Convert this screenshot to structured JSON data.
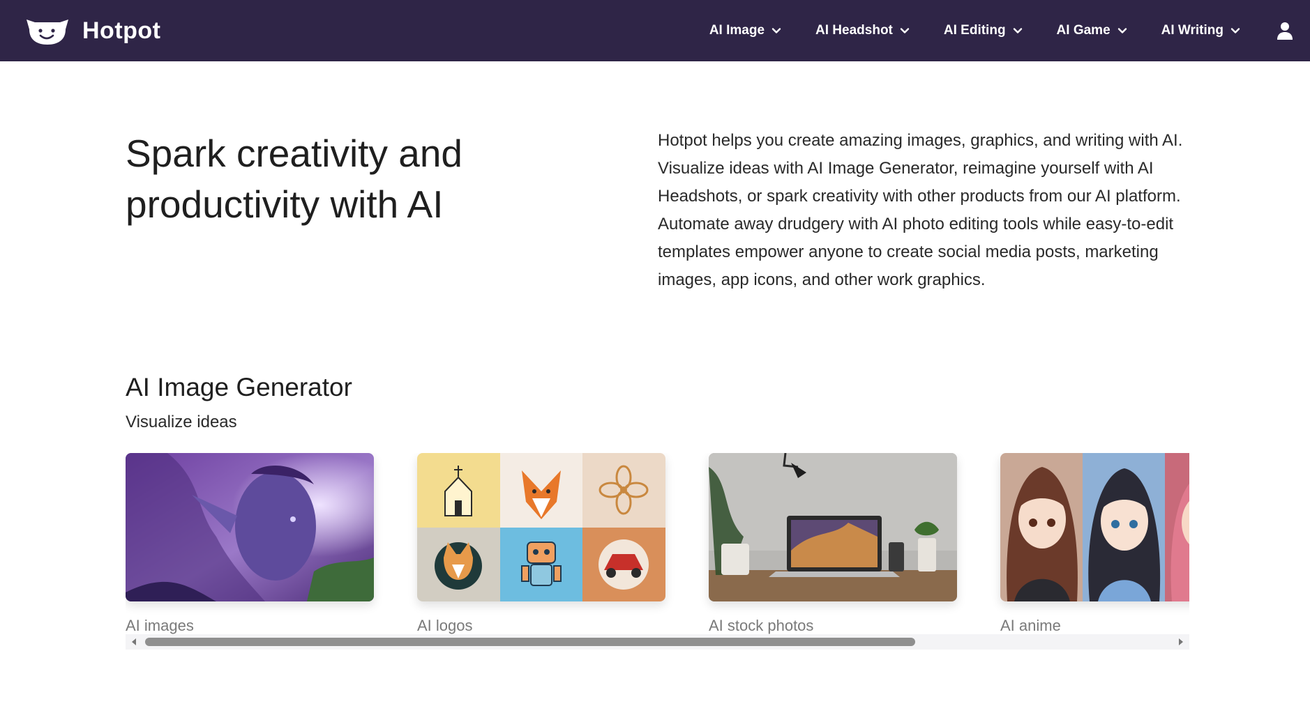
{
  "header": {
    "brand": "Hotpot",
    "nav": [
      {
        "label": "AI Image"
      },
      {
        "label": "AI Headshot"
      },
      {
        "label": "AI Editing"
      },
      {
        "label": "AI Game"
      },
      {
        "label": "AI Writing"
      }
    ],
    "colors": {
      "background": "#2f2547",
      "text": "#ffffff"
    }
  },
  "hero": {
    "title": "Spark creativity and productivity with AI",
    "description": "Hotpot helps you create amazing images, graphics, and writing with AI. Visualize ideas with AI Image Generator, reimagine yourself with AI Headshots, or spark creativity with other products from our AI platform. Automate away drudgery with AI photo editing tools while easy-to-edit templates empower anyone to create social media posts, marketing images, app icons, and other work graphics."
  },
  "section": {
    "title": "AI Image Generator",
    "subtitle": "Visualize ideas",
    "cards": [
      {
        "label": "AI images"
      },
      {
        "label": "AI logos"
      },
      {
        "label": "AI stock photos"
      },
      {
        "label": "AI anime"
      }
    ]
  },
  "icons": {
    "logo": "hotpot-smiling-face-logo",
    "nav_chevron": "chevron-down-icon",
    "user": "user-icon",
    "scroll_left": "scroll-left-arrow-icon",
    "scroll_right": "scroll-right-arrow-icon"
  }
}
